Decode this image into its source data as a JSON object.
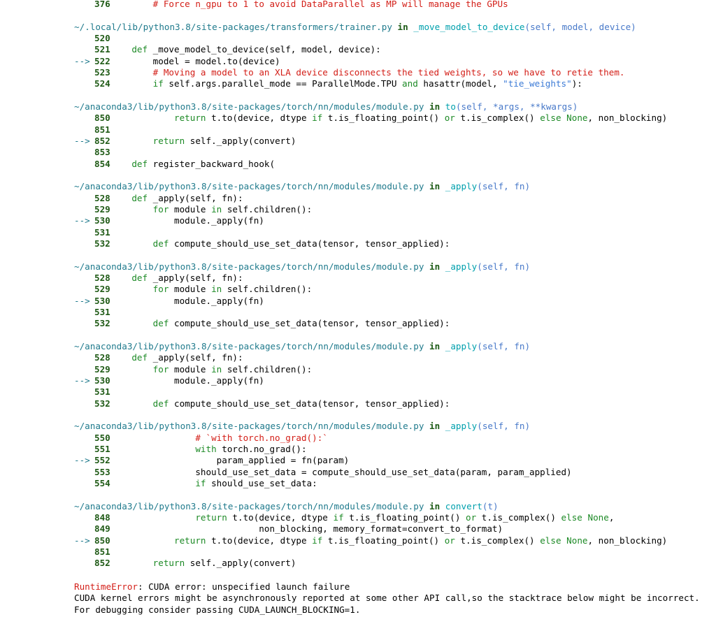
{
  "traceback": {
    "top_line": {
      "num": "376",
      "code": "        # Force n_gpu to 1 to avoid DataParallel as MP will manage the GPUs"
    },
    "frames": [
      {
        "file": "~/.local/lib/python3.8/site-packages/transformers/trainer.py",
        "in": "in",
        "func": "_move_model_to_device",
        "args": "(self, model, device)",
        "lines": [
          {
            "arrow": "",
            "num": "520",
            "code": ""
          },
          {
            "arrow": "",
            "num": "521",
            "code": "    def _move_model_to_device(self, model, device):"
          },
          {
            "arrow": "-->",
            "num": "522",
            "code": "        model = model.to(device)"
          },
          {
            "arrow": "",
            "num": "523",
            "code": "        # Moving a model to an XLA device disconnects the tied weights, so we have to retie them."
          },
          {
            "arrow": "",
            "num": "524",
            "code": "        if self.args.parallel_mode == ParallelMode.TPU and hasattr(model, \"tie_weights\"):"
          }
        ]
      },
      {
        "file": "~/anaconda3/lib/python3.8/site-packages/torch/nn/modules/module.py",
        "in": "in",
        "func": "to",
        "args": "(self, *args, **kwargs)",
        "lines": [
          {
            "arrow": "",
            "num": "850",
            "code": "            return t.to(device, dtype if t.is_floating_point() or t.is_complex() else None, non_blocking)"
          },
          {
            "arrow": "",
            "num": "851",
            "code": ""
          },
          {
            "arrow": "-->",
            "num": "852",
            "code": "        return self._apply(convert)"
          },
          {
            "arrow": "",
            "num": "853",
            "code": ""
          },
          {
            "arrow": "",
            "num": "854",
            "code": "    def register_backward_hook("
          }
        ]
      },
      {
        "file": "~/anaconda3/lib/python3.8/site-packages/torch/nn/modules/module.py",
        "in": "in",
        "func": "_apply",
        "args": "(self, fn)",
        "lines": [
          {
            "arrow": "",
            "num": "528",
            "code": "    def _apply(self, fn):"
          },
          {
            "arrow": "",
            "num": "529",
            "code": "        for module in self.children():"
          },
          {
            "arrow": "-->",
            "num": "530",
            "code": "            module._apply(fn)"
          },
          {
            "arrow": "",
            "num": "531",
            "code": ""
          },
          {
            "arrow": "",
            "num": "532",
            "code": "        def compute_should_use_set_data(tensor, tensor_applied):"
          }
        ]
      },
      {
        "file": "~/anaconda3/lib/python3.8/site-packages/torch/nn/modules/module.py",
        "in": "in",
        "func": "_apply",
        "args": "(self, fn)",
        "lines": [
          {
            "arrow": "",
            "num": "528",
            "code": "    def _apply(self, fn):"
          },
          {
            "arrow": "",
            "num": "529",
            "code": "        for module in self.children():"
          },
          {
            "arrow": "-->",
            "num": "530",
            "code": "            module._apply(fn)"
          },
          {
            "arrow": "",
            "num": "531",
            "code": ""
          },
          {
            "arrow": "",
            "num": "532",
            "code": "        def compute_should_use_set_data(tensor, tensor_applied):"
          }
        ]
      },
      {
        "file": "~/anaconda3/lib/python3.8/site-packages/torch/nn/modules/module.py",
        "in": "in",
        "func": "_apply",
        "args": "(self, fn)",
        "lines": [
          {
            "arrow": "",
            "num": "528",
            "code": "    def _apply(self, fn):"
          },
          {
            "arrow": "",
            "num": "529",
            "code": "        for module in self.children():"
          },
          {
            "arrow": "-->",
            "num": "530",
            "code": "            module._apply(fn)"
          },
          {
            "arrow": "",
            "num": "531",
            "code": ""
          },
          {
            "arrow": "",
            "num": "532",
            "code": "        def compute_should_use_set_data(tensor, tensor_applied):"
          }
        ]
      },
      {
        "file": "~/anaconda3/lib/python3.8/site-packages/torch/nn/modules/module.py",
        "in": "in",
        "func": "_apply",
        "args": "(self, fn)",
        "lines": [
          {
            "arrow": "",
            "num": "550",
            "code": "                # `with torch.no_grad():`"
          },
          {
            "arrow": "",
            "num": "551",
            "code": "                with torch.no_grad():"
          },
          {
            "arrow": "-->",
            "num": "552",
            "code": "                    param_applied = fn(param)"
          },
          {
            "arrow": "",
            "num": "553",
            "code": "                should_use_set_data = compute_should_use_set_data(param, param_applied)"
          },
          {
            "arrow": "",
            "num": "554",
            "code": "                if should_use_set_data:"
          }
        ]
      },
      {
        "file": "~/anaconda3/lib/python3.8/site-packages/torch/nn/modules/module.py",
        "in": "in",
        "func": "convert",
        "args": "(t)",
        "lines": [
          {
            "arrow": "",
            "num": "848",
            "code": "                return t.to(device, dtype if t.is_floating_point() or t.is_complex() else None,"
          },
          {
            "arrow": "",
            "num": "849",
            "code": "                            non_blocking, memory_format=convert_to_format)"
          },
          {
            "arrow": "-->",
            "num": "850",
            "code": "            return t.to(device, dtype if t.is_floating_point() or t.is_complex() else None, non_blocking)"
          },
          {
            "arrow": "",
            "num": "851",
            "code": ""
          },
          {
            "arrow": "",
            "num": "852",
            "code": "        return self._apply(convert)"
          }
        ]
      }
    ],
    "error": {
      "type": "RuntimeError",
      "message": ": CUDA error: unspecified launch failure",
      "detail_1": "CUDA kernel errors might be asynchronously reported at some other API call,so the stacktrace below might be incorrect.",
      "detail_2": "For debugging consider passing CUDA_LAUNCH_BLOCKING=1."
    }
  }
}
